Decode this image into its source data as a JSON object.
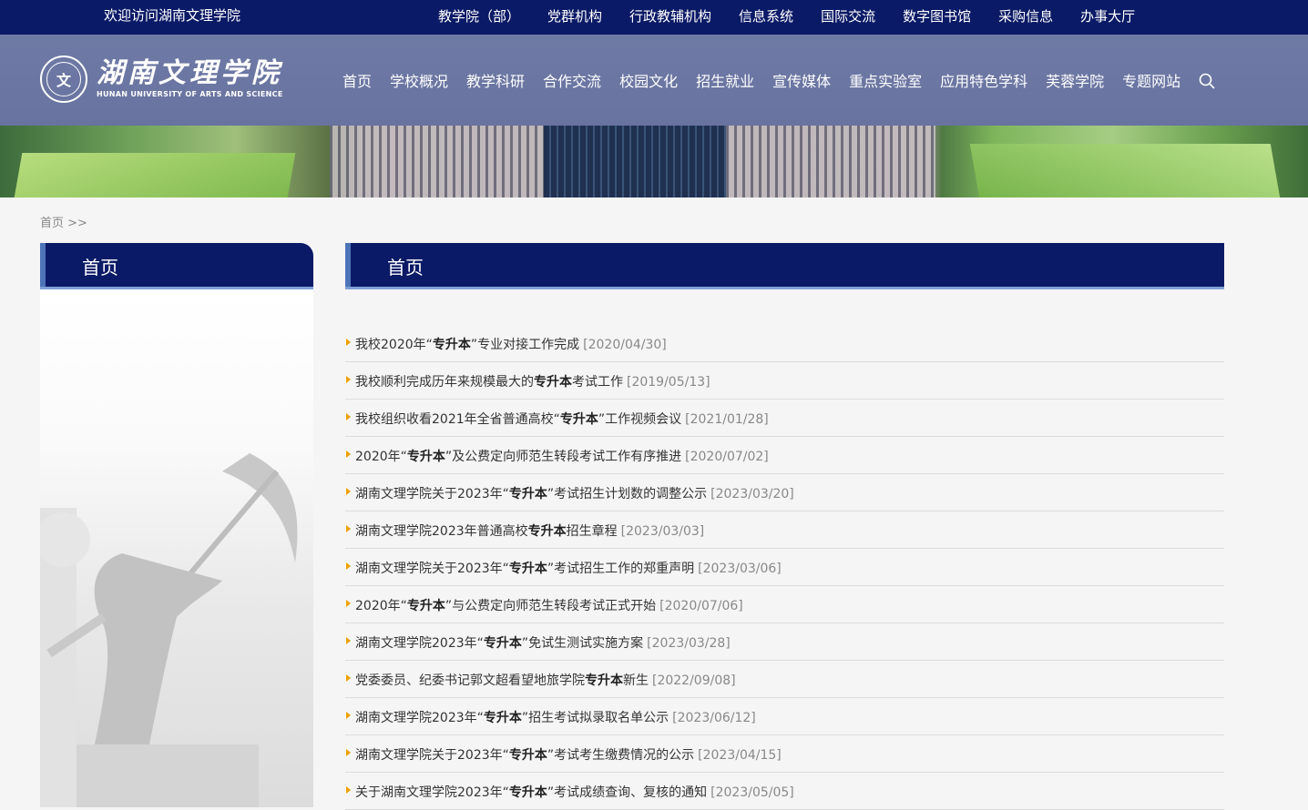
{
  "topbar": {
    "welcome": "欢迎访问湖南文理学院",
    "links": [
      "教学院（部）",
      "党群机构",
      "行政教辅机构",
      "信息系统",
      "国际交流",
      "数字图书馆",
      "采购信息",
      "办事大厅"
    ]
  },
  "logo": {
    "cn": "湖南文理学院",
    "en": "HUNAN UNIVERSITY OF ARTS AND SCIENCE"
  },
  "nav": [
    "首页",
    "学校概况",
    "教学科研",
    "合作交流",
    "校园文化",
    "招生就业",
    "宣传媒体",
    "重点实验室",
    "应用特色学科",
    "芙蓉学院",
    "专题网站"
  ],
  "breadcrumb": {
    "home": "首页",
    "sep": ">>"
  },
  "sidebar": {
    "title": "首页"
  },
  "main": {
    "title": "首页"
  },
  "news": [
    {
      "pre": "我校2020年“",
      "kw": "专升本",
      "post": "”专业对接工作完成",
      "date": "[2020/04/30]"
    },
    {
      "pre": "我校顺利完成历年来规模最大的",
      "kw": "专升本",
      "post": "考试工作",
      "date": "[2019/05/13]"
    },
    {
      "pre": "我校组织收看2021年全省普通高校“",
      "kw": "专升本",
      "post": "”工作视频会议",
      "date": "[2021/01/28]"
    },
    {
      "pre": "2020年“",
      "kw": "专升本",
      "post": "”及公费定向师范生转段考试工作有序推进",
      "date": "[2020/07/02]"
    },
    {
      "pre": "湖南文理学院关于2023年“",
      "kw": "专升本",
      "post": "”考试招生计划数的调整公示",
      "date": "[2023/03/20]"
    },
    {
      "pre": "湖南文理学院2023年普通高校",
      "kw": "专升本",
      "post": "招生章程",
      "date": "[2023/03/03]"
    },
    {
      "pre": "湖南文理学院关于2023年“",
      "kw": "专升本",
      "post": "”考试招生工作的郑重声明",
      "date": "[2023/03/06]"
    },
    {
      "pre": "2020年“",
      "kw": "专升本",
      "post": "”与公费定向师范生转段考试正式开始",
      "date": "[2020/07/06]"
    },
    {
      "pre": "湖南文理学院2023年“",
      "kw": "专升本",
      "post": "”免试生测试实施方案",
      "date": "[2023/03/28]"
    },
    {
      "pre": "党委委员、纪委书记郭文超看望地旅学院",
      "kw": "专升本",
      "post": "新生",
      "date": "[2022/09/08]"
    },
    {
      "pre": "湖南文理学院2023年“",
      "kw": "专升本",
      "post": "”招生考试拟录取名单公示",
      "date": "[2023/06/12]"
    },
    {
      "pre": "湖南文理学院关于2023年“",
      "kw": "专升本",
      "post": "”考试考生缴费情况的公示",
      "date": "[2023/04/15]"
    },
    {
      "pre": "关于湖南文理学院2023年“",
      "kw": "专升本",
      "post": "”考试成绩查询、复核的通知",
      "date": "[2023/05/05]"
    }
  ]
}
